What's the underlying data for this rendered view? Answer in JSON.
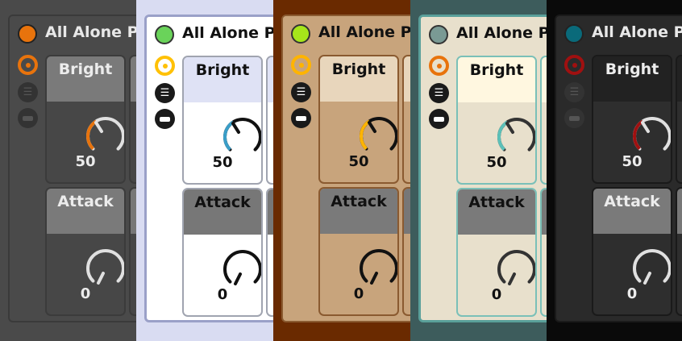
{
  "device": {
    "title": "All Alone Pa",
    "bright_label": "Bright",
    "bright_value": "50",
    "attack_label": "Attack",
    "attack_value": "0"
  },
  "themes": [
    {
      "name": "dark",
      "bg": "#4a4a4a",
      "panel": "#4a4a4a",
      "panel_border": "#3a3a3a",
      "dot": "#e8730c",
      "accent": "#e8730c",
      "title": "#e8e8e8",
      "card_head": "#7a7a7a",
      "card_body": "#474747",
      "card_border": "#3b3b3b",
      "label": "#ececec",
      "knob": "#e0e0e0",
      "arc": "#e8730c"
    },
    {
      "name": "light",
      "bg": "#d9dcf2",
      "panel": "#ffffff",
      "panel_border": "#9aa0c8",
      "dot": "#6ad35a",
      "accent": "#ffc107",
      "title": "#111111",
      "card_head": "#dfe2f5",
      "card_body": "#ffffff",
      "card_border": "#a0a4b0",
      "label": "#111111",
      "knob": "#111111",
      "arc": "#3a9ec8"
    },
    {
      "name": "tan",
      "bg": "#6a2a00",
      "panel": "#c8a47c",
      "panel_border": "#8a5a30",
      "dot": "#a6e61a",
      "accent": "#ffb400",
      "title": "#111111",
      "card_head": "#e8d6bc",
      "card_body": "#c8a47c",
      "card_border": "#8a5a30",
      "label": "#111111",
      "knob": "#111111",
      "arc": "#ffb400"
    },
    {
      "name": "sage",
      "bg": "#3d5c5c",
      "panel": "#e8e0cc",
      "panel_border": "#5aa09a",
      "dot": "#7a9a94",
      "accent": "#e8730c",
      "title": "#111111",
      "card_head": "#fff7e0",
      "card_body": "#e8e0cc",
      "card_border": "#7ac0b8",
      "label": "#111111",
      "knob": "#333333",
      "arc": "#5cc0b8"
    },
    {
      "name": "black",
      "bg": "#0a0a0a",
      "panel": "#2a2a2a",
      "panel_border": "#1a1a1a",
      "dot": "#0a6a7a",
      "accent": "#a01010",
      "title": "#e8e8e8",
      "card_head": "#222222",
      "card_body": "#2e2e2e",
      "card_border": "#1a1a1a",
      "label": "#ececec",
      "knob": "#e0e0e0",
      "arc": "#a01010"
    }
  ]
}
